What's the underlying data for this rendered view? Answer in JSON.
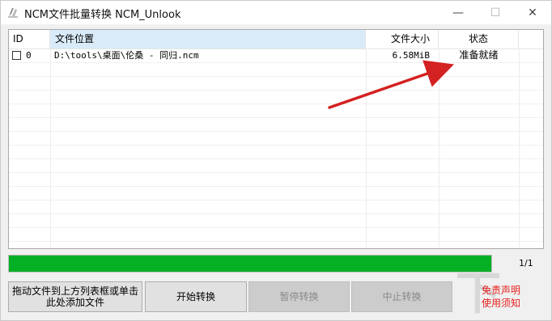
{
  "window": {
    "title": "NCM文件批量转换 NCM_Unlook",
    "controls": {
      "minimize": "—",
      "maximize": "☐",
      "close": "✕"
    }
  },
  "list": {
    "headers": {
      "id": "ID",
      "location": "文件位置",
      "size": "文件大小",
      "status": "状态"
    },
    "rows": [
      {
        "checked": false,
        "id": "0",
        "location": "D:\\tools\\桌面\\伦桑 - 同归.ncm",
        "size": "6.58MiB",
        "status": "准备就绪"
      }
    ]
  },
  "progress": {
    "value": 1.0,
    "page": "1/1",
    "color": "#06b025"
  },
  "buttons": {
    "add_files": "拖动文件到上方列表框或单击此处添加文件",
    "start": "开始转换",
    "pause": "暂停转换",
    "stop": "中止转换"
  },
  "disclaimer": {
    "line1": "免责声明",
    "line2": "使用须知",
    "color": "#e8201e"
  },
  "annotation": {
    "arrow_color": "#d42121"
  },
  "watermark": "下"
}
